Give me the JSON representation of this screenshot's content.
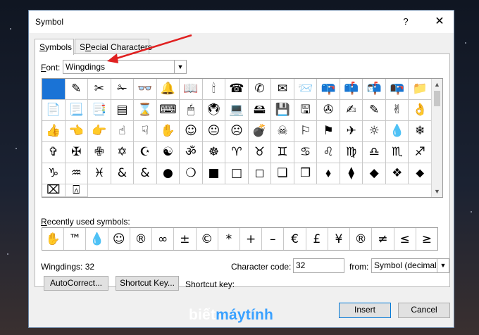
{
  "dialog": {
    "title": "Symbol",
    "help_label": "?",
    "close_label": "✕"
  },
  "tabs": [
    {
      "label": "Symbols",
      "underline": "S",
      "rest": "ymbols"
    },
    {
      "label": "Special Characters",
      "underline": "P",
      "pre": "S",
      "rest": "ecial Characters"
    }
  ],
  "font": {
    "label_u": "F",
    "label_rest": "ont:",
    "value": "Wingdings"
  },
  "symbol_grid": [
    "",
    "✎",
    "✂",
    "✁",
    "👓",
    "🔔",
    "📖",
    "🕯",
    "☎",
    "✆",
    "✉",
    "📨",
    "📪",
    "📫",
    "📬",
    "📭",
    "📁",
    "📄",
    "📃",
    "📑",
    "▤",
    "⌛",
    "⌨",
    "🖱",
    "🖲",
    "💻",
    "🖴",
    "💾",
    "🖫",
    "✇",
    "✍",
    "✎",
    "✌",
    "👌",
    "👍",
    "👈",
    "👉",
    "☝",
    "☟",
    "✋",
    "☺",
    "😐",
    "☹",
    "💣",
    "☠",
    "⚐",
    "⚑",
    "✈",
    "☼",
    "💧",
    "❄",
    "✞",
    "✠",
    "✙",
    "✡",
    "☪",
    "☯",
    "ॐ",
    "☸",
    "♈",
    "♉",
    "♊",
    "♋",
    "♌",
    "♍",
    "♎",
    "♏",
    "♐",
    "♑",
    "♒",
    "♓",
    "&",
    "&",
    "●",
    "❍",
    "■",
    "□",
    "◻",
    "❑",
    "❒",
    "⬧",
    "⧫",
    "◆",
    "❖",
    "⬥",
    "⌧",
    "⍓"
  ],
  "recent": {
    "label_u": "R",
    "label_rest": "ecently used symbols:",
    "symbols": [
      "✋",
      "™",
      "💧",
      "☺",
      "®",
      "∞",
      "±",
      "©",
      "*",
      "+",
      "–",
      "€",
      "£",
      "¥",
      "®",
      "≠",
      "≤",
      "≥"
    ]
  },
  "character_name": "Wingdings: 32",
  "character_code": {
    "label": "Character code:",
    "value": "32"
  },
  "from": {
    "label": "from:",
    "value": "Symbol (decimal)"
  },
  "buttons": {
    "autocorrect": "AutoCorrect...",
    "shortcut_key": "Shortcut Key...",
    "insert": "Insert",
    "cancel": "Cancel"
  },
  "shortcut_key_label": "Shortcut key:",
  "watermark": {
    "part1": "biết",
    "part2": "máytính"
  },
  "colors": {
    "accent": "#1a73d6",
    "arrow": "#e02020",
    "watermark_blue": "#3aa1ff"
  }
}
